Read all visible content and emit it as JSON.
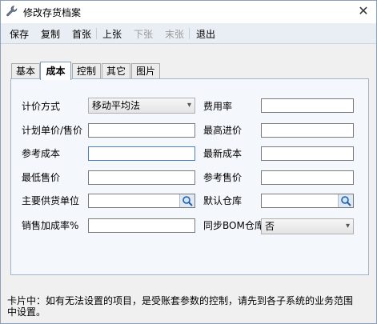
{
  "window": {
    "title": "修改存货档案",
    "close_glyph": "✕"
  },
  "toolbar": {
    "items": [
      {
        "label": "保存",
        "enabled": true
      },
      {
        "label": "复制",
        "enabled": true
      },
      {
        "label": "首张",
        "enabled": true
      },
      {
        "label": "上张",
        "enabled": true
      },
      {
        "label": "下张",
        "enabled": false
      },
      {
        "label": "末张",
        "enabled": false
      },
      {
        "label": "退出",
        "enabled": true
      }
    ]
  },
  "tabs": [
    {
      "label": "基本",
      "active": false
    },
    {
      "label": "成本",
      "active": true
    },
    {
      "label": "控制",
      "active": false
    },
    {
      "label": "其它",
      "active": false
    },
    {
      "label": "图片",
      "active": false
    }
  ],
  "form": {
    "pricing_method": {
      "label": "计价方式",
      "value": "移动平均法"
    },
    "expense_rate": {
      "label": "费用率",
      "value": ""
    },
    "plan_price": {
      "label": "计划单价/售价",
      "value": ""
    },
    "max_purchase_price": {
      "label": "最高进价",
      "value": ""
    },
    "reference_cost": {
      "label": "参考成本",
      "value": ""
    },
    "latest_cost": {
      "label": "最新成本",
      "value": ""
    },
    "min_sale_price": {
      "label": "最低售价",
      "value": ""
    },
    "reference_sale_price": {
      "label": "参考售价",
      "value": ""
    },
    "main_supplier": {
      "label": "主要供货单位",
      "value": ""
    },
    "default_warehouse": {
      "label": "默认仓库",
      "value": ""
    },
    "sale_markup_rate": {
      "label": "销售加成率%",
      "value": ""
    },
    "sync_bom_warehouse": {
      "label": "同步BOM仓库",
      "value": "否"
    }
  },
  "footer": {
    "note": "卡片中：如有无法设置的项目，是受账套参数的控制，请先到各子系统的业务范围中设置。"
  },
  "colors": {
    "accent": "#4a7dbd",
    "toolbar_bg": "#e9eef5",
    "panel_bg": "#f4f7fb"
  }
}
